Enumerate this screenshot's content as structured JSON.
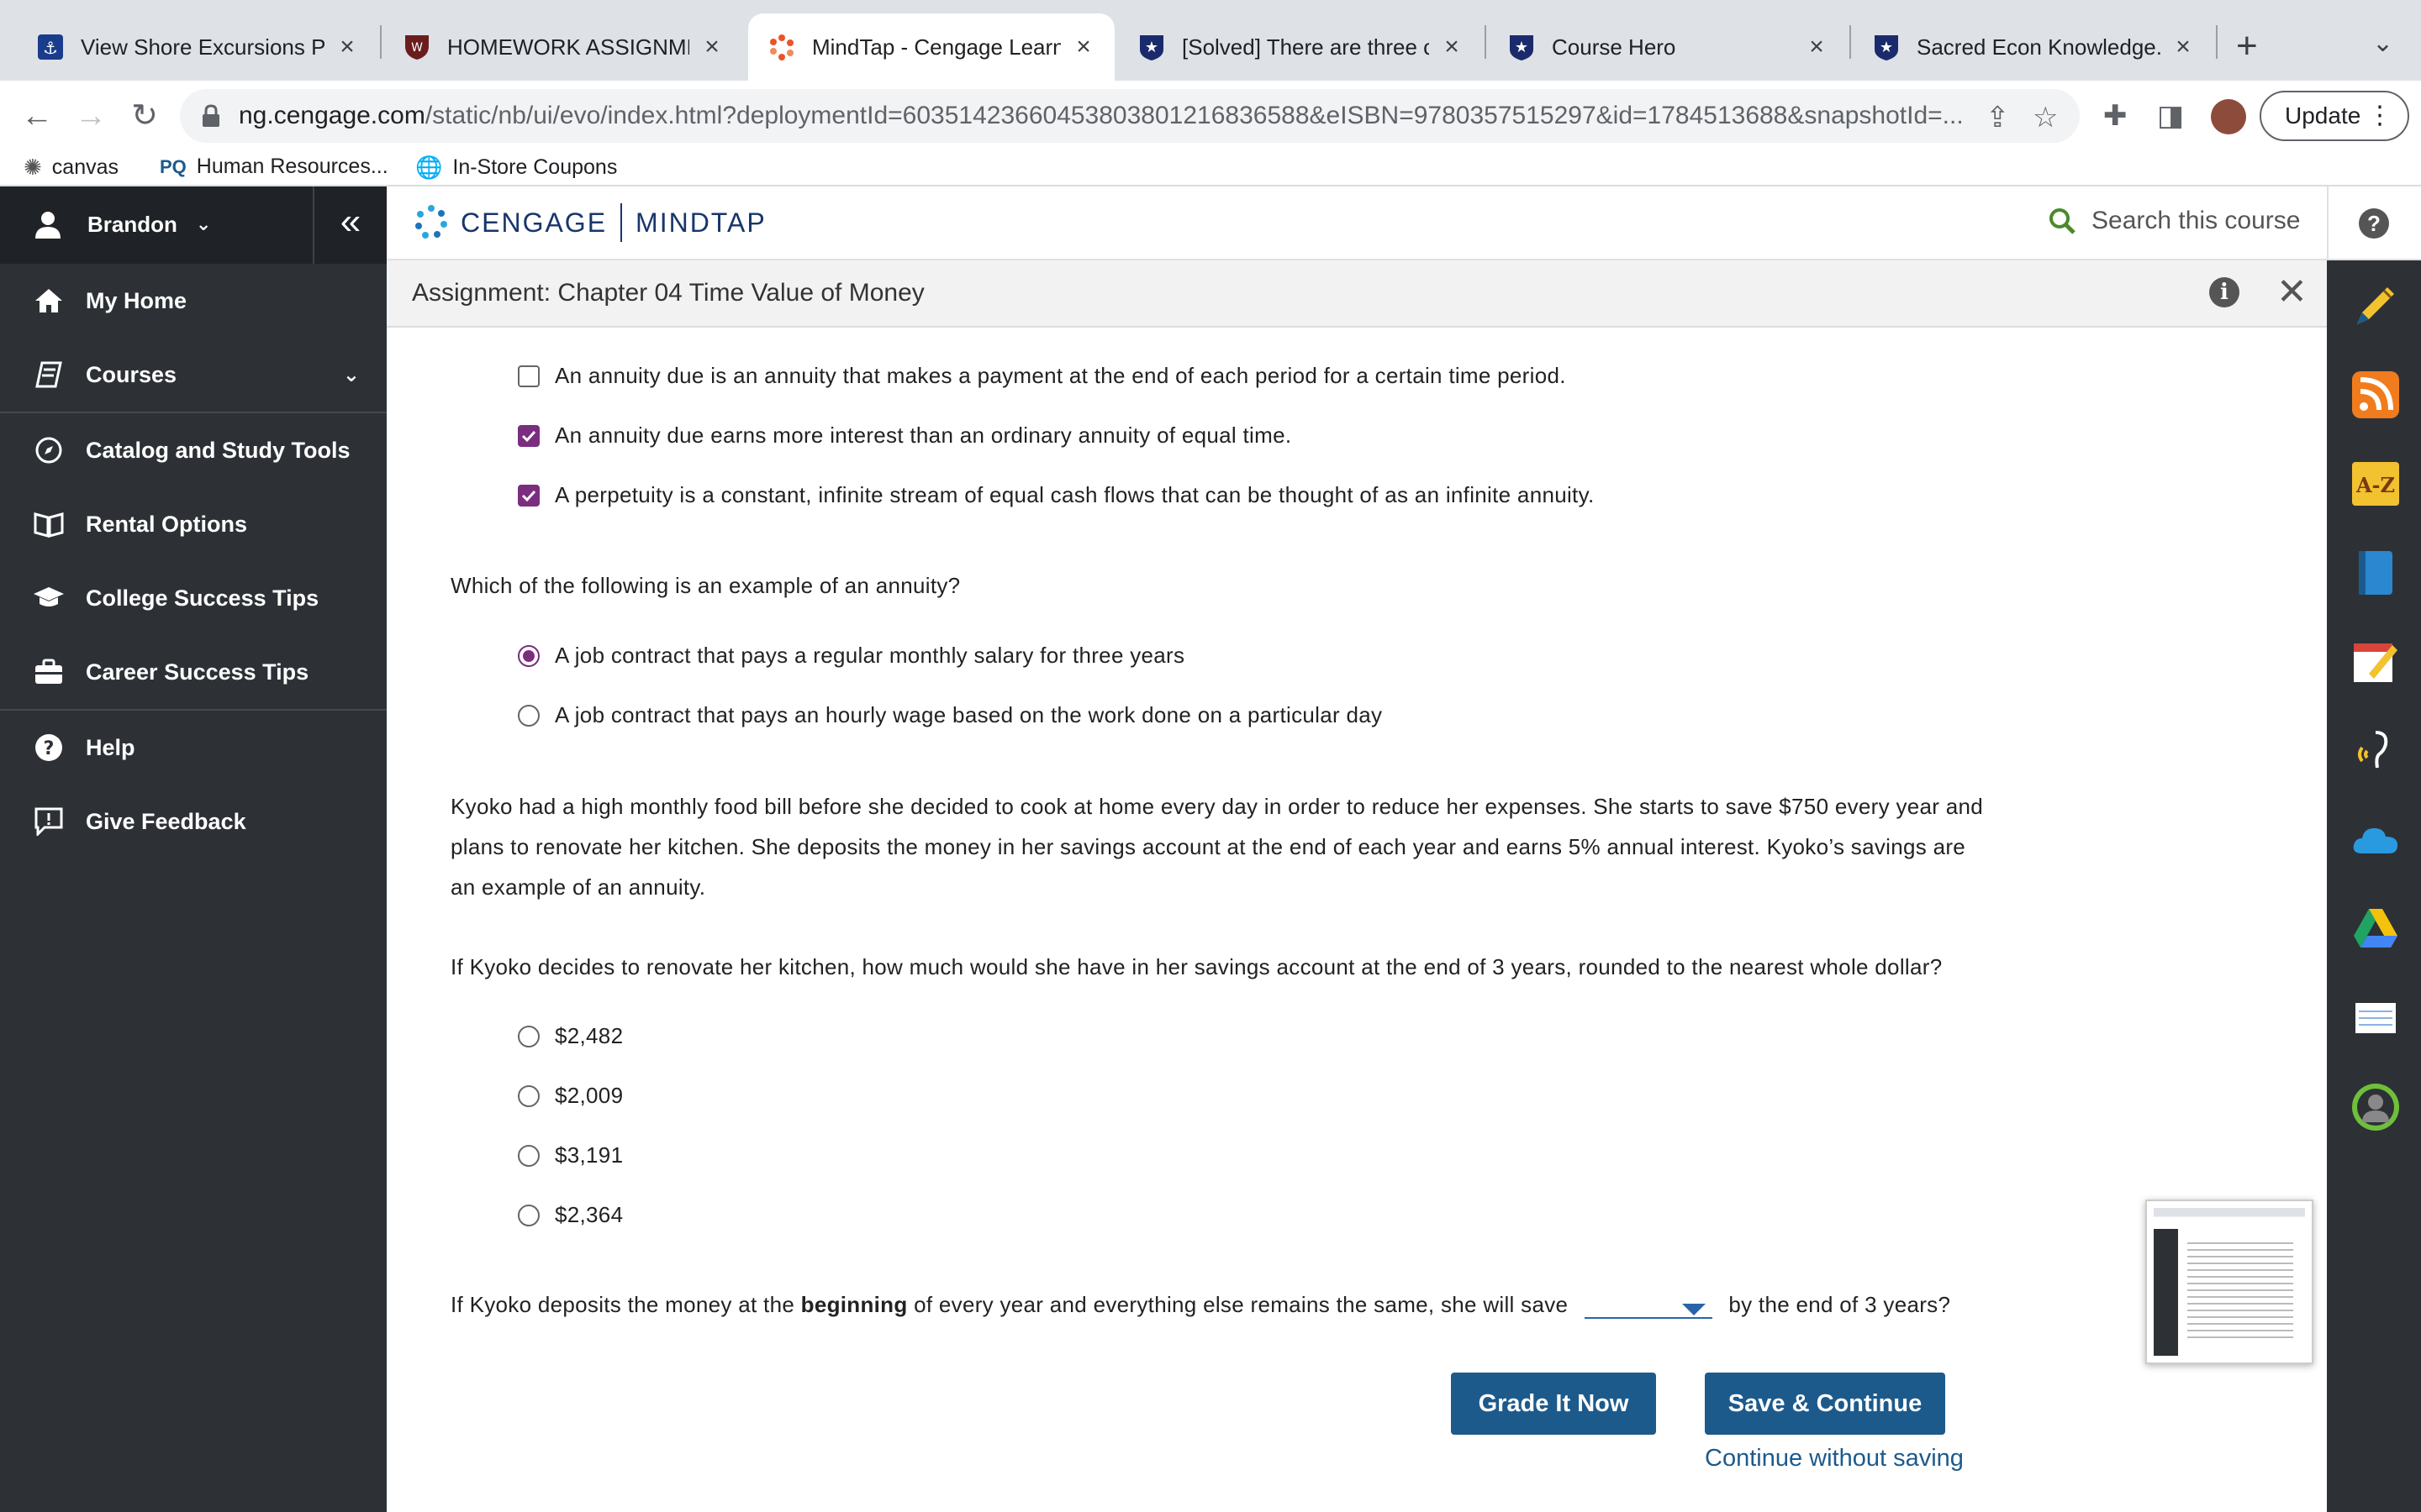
{
  "browser": {
    "tabs": [
      {
        "title": "View Shore Excursions Prod",
        "active": false
      },
      {
        "title": "HOMEWORK ASSIGNMENT",
        "active": false
      },
      {
        "title": "MindTap - Cengage Learnin",
        "active": true
      },
      {
        "title": "[Solved] There are three ca",
        "active": false
      },
      {
        "title": "Course Hero",
        "active": false
      },
      {
        "title": "Sacred Econ Knowledge.pd",
        "active": false
      }
    ],
    "url_host": "ng.cengage.com",
    "url_path": "/static/nb/ui/evo/index.html?deploymentId=60351423660453803801216836588&eISBN=9780357515297&id=1784513688&snapshotId=...",
    "update_label": "Update",
    "bookmarks": [
      {
        "label": "canvas",
        "icon": "canvas-icon"
      },
      {
        "label": "Human Resources...",
        "icon": "pq-icon"
      },
      {
        "label": "In-Store Coupons",
        "icon": "globe-icon"
      }
    ]
  },
  "sidebar": {
    "user": "Brandon",
    "items": [
      {
        "label": "My Home",
        "icon": "home-icon"
      },
      {
        "label": "Courses",
        "icon": "book-icon"
      },
      {
        "label": "Catalog and Study Tools",
        "icon": "compass-icon"
      },
      {
        "label": "Rental Options",
        "icon": "open-book-icon"
      },
      {
        "label": "College Success Tips",
        "icon": "graduation-cap-icon"
      },
      {
        "label": "Career Success Tips",
        "icon": "briefcase-icon"
      },
      {
        "label": "Help",
        "icon": "help-icon"
      },
      {
        "label": "Give Feedback",
        "icon": "feedback-icon"
      }
    ]
  },
  "header": {
    "brand_left": "CENGAGE",
    "brand_right": "MINDTAP",
    "search_placeholder": "Search this course",
    "assignment_title": "Assignment: Chapter 04 Time Value of Money"
  },
  "content": {
    "checkbox_options": [
      {
        "text": "An annuity due is an annuity that makes a payment at the end of each period for a certain time period.",
        "checked": false
      },
      {
        "text": "An annuity due earns more interest than an ordinary annuity of equal time.",
        "checked": true
      },
      {
        "text": "A perpetuity is a constant, infinite stream of equal cash flows that can be thought of as an infinite annuity.",
        "checked": true
      }
    ],
    "q_annuity": "Which of the following is an example of an annuity?",
    "annuity_options": [
      {
        "text": "A job contract that pays a regular monthly salary for three years",
        "selected": true
      },
      {
        "text": "A job contract that pays an hourly wage based on the work done on a particular day",
        "selected": false
      }
    ],
    "scenario": "Kyoko had a high monthly food bill before she decided to cook at home every day in order to reduce her expenses. She starts to save $750 every year and plans to renovate her kitchen. She deposits the money in her savings account at the end of each year and earns 5% annual interest. Kyoko’s savings are an example of an annuity.",
    "q_kitchen": "If Kyoko decides to renovate her kitchen, how much would she have in her savings account at the end of 3 years, rounded to the nearest whole dollar?",
    "amount_options": [
      "$2,482",
      "$2,009",
      "$3,191",
      "$2,364"
    ],
    "q_beginning_pre": "If Kyoko deposits the money at the",
    "q_beginning_bold": "beginning",
    "q_beginning_mid": "of every year and everything else remains the same, she will save",
    "q_beginning_post": "by the end of 3 years?",
    "grade_label": "Grade It Now",
    "save_label": "Save & Continue",
    "continue_label": "Continue without saving"
  },
  "colors": {
    "accent_purple": "#7b2d7f",
    "button_blue": "#1d5a8c",
    "sidebar_bg": "#2d3136"
  }
}
